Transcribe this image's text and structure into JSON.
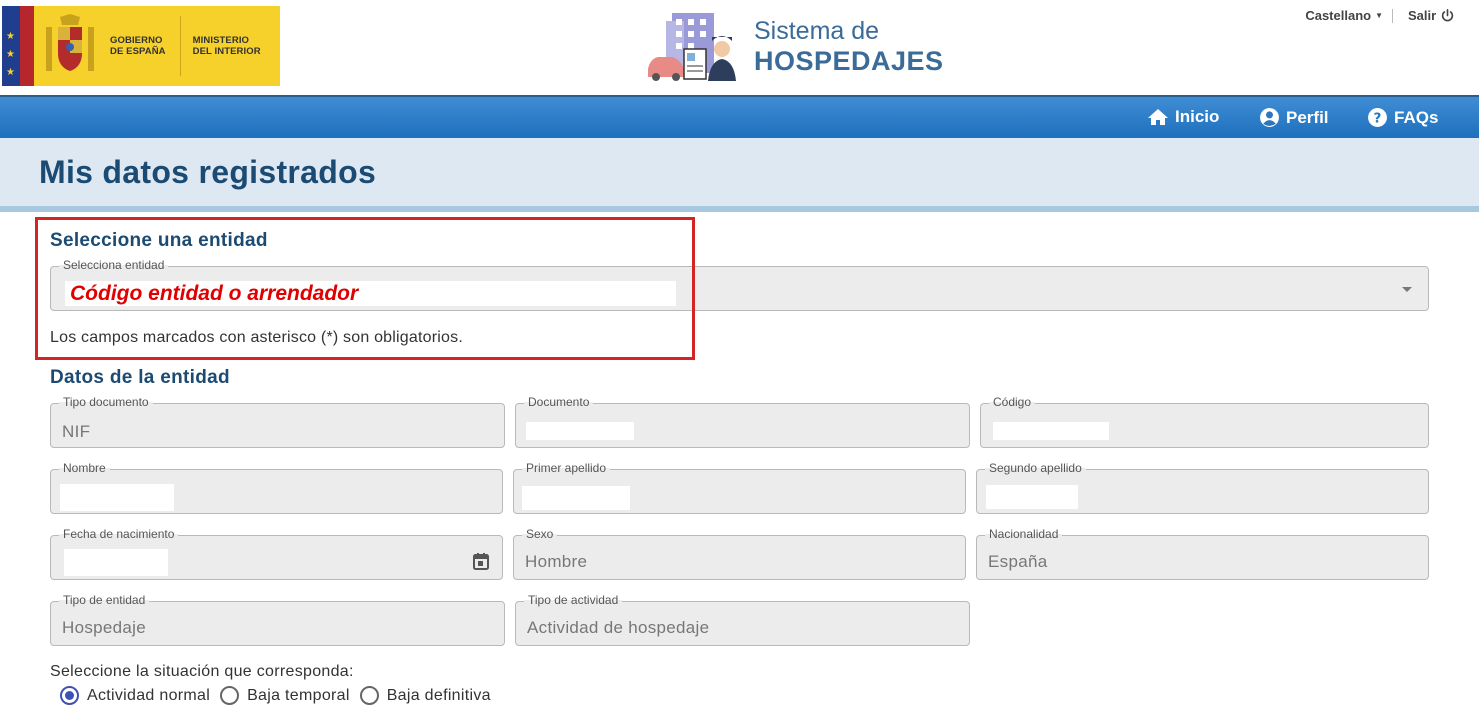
{
  "header": {
    "gov_line1": "GOBIERNO",
    "gov_line2": "DE ESPAÑA",
    "ministry_line1": "MINISTERIO",
    "ministry_line2": "DEL INTERIOR",
    "brand_line1": "Sistema de",
    "brand_line2": "HOSPEDAJES",
    "language": "Castellano",
    "logout": "Salir"
  },
  "nav": {
    "home": "Inicio",
    "profile": "Perfil",
    "faqs": "FAQs"
  },
  "page_title": "Mis datos registrados",
  "select_entity": {
    "heading": "Seleccione una entidad",
    "label": "Selecciona entidad",
    "overlay_text": "Código entidad o arrendador",
    "note": "Los campos marcados con asterisco (*) son obligatorios."
  },
  "entity_data": {
    "heading": "Datos de la entidad",
    "fields": {
      "doc_type": {
        "label": "Tipo documento",
        "value": "NIF"
      },
      "document": {
        "label": "Documento",
        "value": ""
      },
      "code": {
        "label": "Código",
        "value": ""
      },
      "name": {
        "label": "Nombre",
        "value": ""
      },
      "surname1": {
        "label": "Primer apellido",
        "value": ""
      },
      "surname2": {
        "label": "Segundo apellido",
        "value": ""
      },
      "birthdate": {
        "label": "Fecha de nacimiento",
        "value": ""
      },
      "sex": {
        "label": "Sexo",
        "value": "Hombre"
      },
      "nationality": {
        "label": "Nacionalidad",
        "value": "España"
      },
      "entity_type": {
        "label": "Tipo de entidad",
        "value": "Hospedaje"
      },
      "activity_type": {
        "label": "Tipo de actividad",
        "value": "Actividad de hospedaje"
      }
    }
  },
  "situation": {
    "prompt": "Seleccione la situación que corresponda:",
    "options": [
      "Actividad normal",
      "Baja temporal",
      "Baja definitiva"
    ],
    "selected": "Actividad normal"
  },
  "colors": {
    "nav_blue": "#1e6fbd",
    "title_blue": "#1b4a72",
    "highlight_red": "#d42424"
  }
}
